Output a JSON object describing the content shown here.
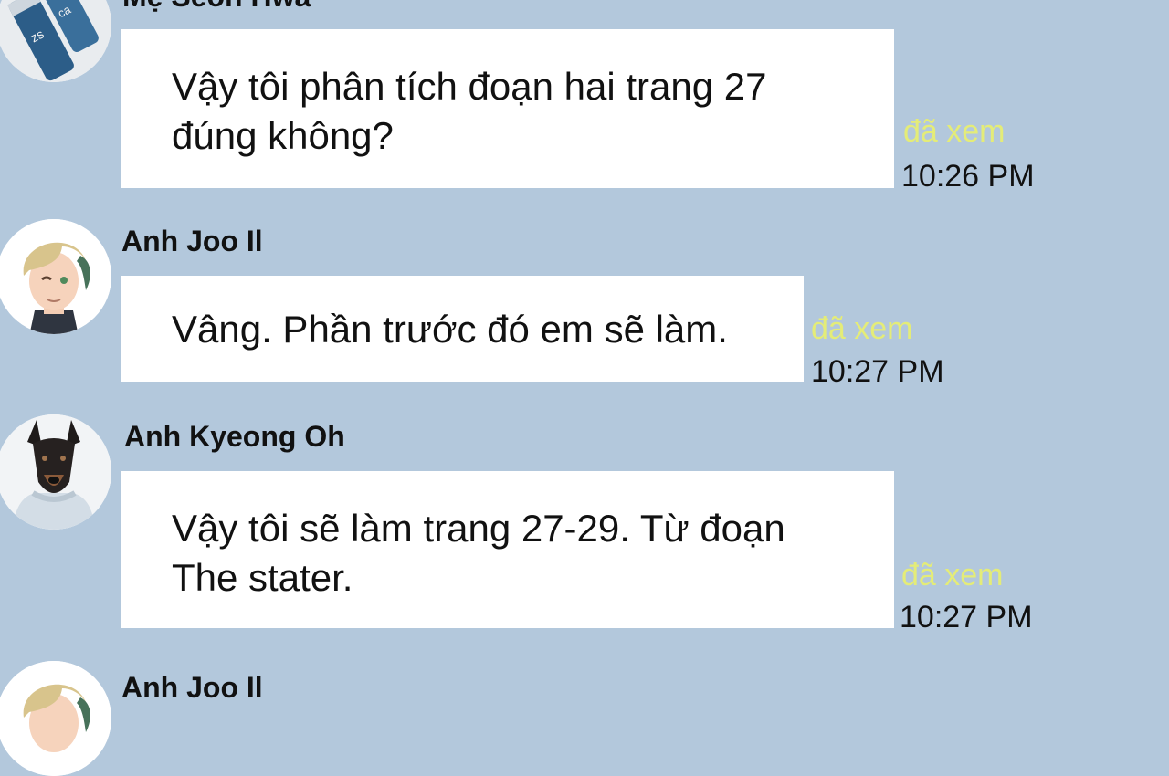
{
  "messages": [
    {
      "sender": "Mẹ Seon Hwa",
      "avatar_icon": "water-bottles-avatar",
      "text_lines": [
        "Vậy tôi phân tích đoạn hai trang 27",
        "đúng không?"
      ],
      "read_label": "đã xem",
      "time": "10:26 PM"
    },
    {
      "sender": "Anh Joo Il",
      "avatar_icon": "blond-boy-avatar",
      "text_lines": [
        "Vâng. Phần trước đó em sẽ làm."
      ],
      "read_label": "đã xem",
      "time": "10:27 PM"
    },
    {
      "sender": "Anh Kyeong Oh",
      "avatar_icon": "doberman-avatar",
      "text_lines": [
        "Vậy tôi sẽ làm trang 27-29. Từ đoạn",
        "The stater."
      ],
      "read_label": "đã xem",
      "time": "10:27 PM"
    },
    {
      "sender": "Anh Joo Il",
      "avatar_icon": "blond-boy-avatar"
    }
  ],
  "colors": {
    "background": "#b3c8dc",
    "bubble": "#ffffff",
    "read_label": "#e4ec78",
    "text": "#111111"
  }
}
